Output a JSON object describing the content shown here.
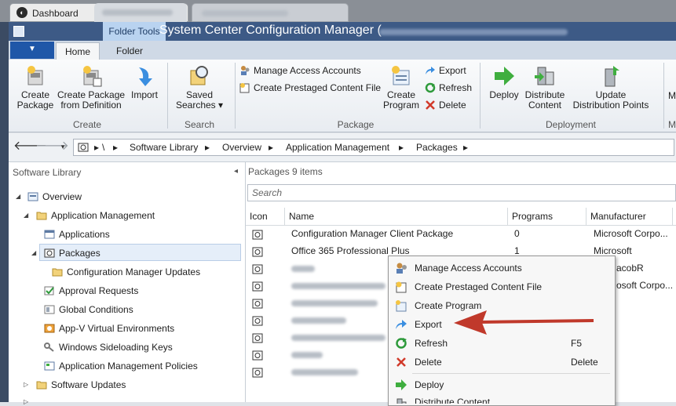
{
  "browser_tabs": [
    {
      "label": "Dashboard"
    }
  ],
  "window": {
    "title": "System Center Configuration Manager (",
    "folder_tools": "Folder Tools"
  },
  "ribbon_tabs": {
    "home": "Home",
    "folder": "Folder"
  },
  "ribbon": {
    "create": {
      "group": "Create",
      "create_package": "Create\nPackage",
      "create_from_def": "Create Package\nfrom Definition",
      "import": "Import"
    },
    "search": {
      "group": "Search",
      "saved_searches": "Saved\nSearches ▾"
    },
    "package": {
      "group": "Package",
      "manage_access": "Manage Access Accounts",
      "prestaged": "Create Prestaged Content File",
      "create_program": "Create\nProgram",
      "export": "Export",
      "refresh": "Refresh",
      "delete": "Delete"
    },
    "deployment": {
      "group": "Deployment",
      "deploy": "Deploy",
      "distribute": "Distribute\nContent",
      "update_dp": "Update\nDistribution Points"
    },
    "more": {
      "label": "M",
      "group": "M"
    }
  },
  "breadcrumb": [
    "\\",
    "Software Library",
    "Overview",
    "Application Management",
    "Packages"
  ],
  "left_pane": {
    "title": "Software Library",
    "tree": {
      "overview": "Overview",
      "app_mgmt": "Application Management",
      "applications": "Applications",
      "packages": "Packages",
      "cm_updates": "Configuration Manager Updates",
      "approval": "Approval Requests",
      "global": "Global Conditions",
      "appv": "App-V Virtual Environments",
      "sideloading": "Windows Sideloading Keys",
      "policies": "Application Management Policies",
      "sw_updates": "Software Updates"
    }
  },
  "right_pane": {
    "header": "Packages 9 items",
    "search_placeholder": "Search",
    "columns": [
      "Icon",
      "Name",
      "Programs",
      "Manufacturer"
    ],
    "rows": [
      {
        "name": "Configuration Manager Client Package",
        "programs": "0",
        "manufacturer": "Microsoft Corpo..."
      },
      {
        "name": "Office 365 Professional Plus",
        "programs": "1",
        "manufacturer": "Microsoft"
      },
      {
        "name": "",
        "programs": "",
        "manufacturer": "acobR"
      },
      {
        "name": "",
        "programs": "",
        "manufacturer": "osoft Corpo..."
      }
    ]
  },
  "context_menu": {
    "items": [
      {
        "label": "Manage Access Accounts",
        "shortcut": ""
      },
      {
        "label": "Create Prestaged Content File",
        "shortcut": ""
      },
      {
        "label": "Create Program",
        "shortcut": ""
      },
      {
        "label": "Export",
        "shortcut": ""
      },
      {
        "label": "Refresh",
        "shortcut": "F5"
      },
      {
        "label": "Delete",
        "shortcut": "Delete"
      },
      {
        "label": "Deploy",
        "shortcut": ""
      },
      {
        "label": "Distribute Content",
        "shortcut": ""
      }
    ]
  },
  "colors": {
    "title_bar": "#3d5a86",
    "file_tab": "#1f57a8",
    "annotation_arrow": "#c0392b"
  }
}
